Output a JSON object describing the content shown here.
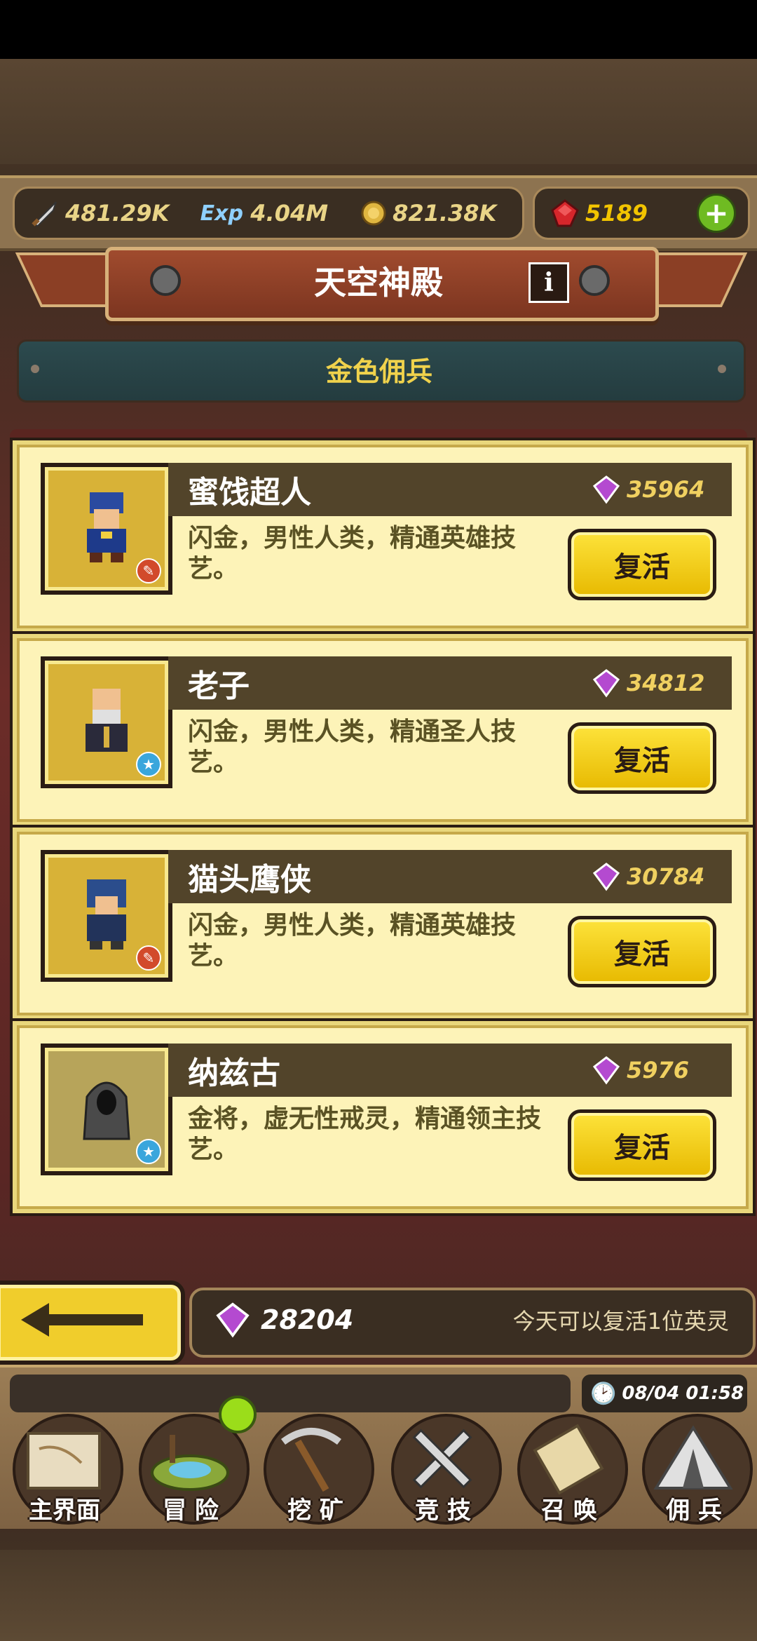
{
  "resources": {
    "attack": "481.29K",
    "exp": "4.04M",
    "gold": "821.38K",
    "gems": "5189",
    "exp_icon_text": "Exp"
  },
  "header": {
    "title": "天空神殿",
    "info_label": "i"
  },
  "section": {
    "title": "金色佣兵"
  },
  "heroes": [
    {
      "name": "蜜饯超人",
      "cost": "35964",
      "desc": "闪金，男性人类，精通英雄技艺。",
      "button": "复活"
    },
    {
      "name": "老子",
      "cost": "34812",
      "desc": "闪金，男性人类，精通圣人技艺。",
      "button": "复活"
    },
    {
      "name": "猫头鹰侠",
      "cost": "30784",
      "desc": "闪金，男性人类，精通英雄技艺。",
      "button": "复活"
    },
    {
      "name": "纳兹古",
      "cost": "5976",
      "desc": "金将，虚无性戒灵，精通领主技艺。",
      "button": "复活"
    }
  ],
  "footer": {
    "gem_total": "28204",
    "revive_hint": "今天可以复活1位英灵"
  },
  "clock": "08/04 01:58",
  "nav": [
    {
      "label": "主界面"
    },
    {
      "label": "冒 险"
    },
    {
      "label": "挖 矿"
    },
    {
      "label": "竞 技"
    },
    {
      "label": "召 唤"
    },
    {
      "label": "佣 兵"
    }
  ],
  "colors": {
    "gem": "#f2c400",
    "card": "#fdf3b8",
    "button": "#f0cd2c"
  }
}
